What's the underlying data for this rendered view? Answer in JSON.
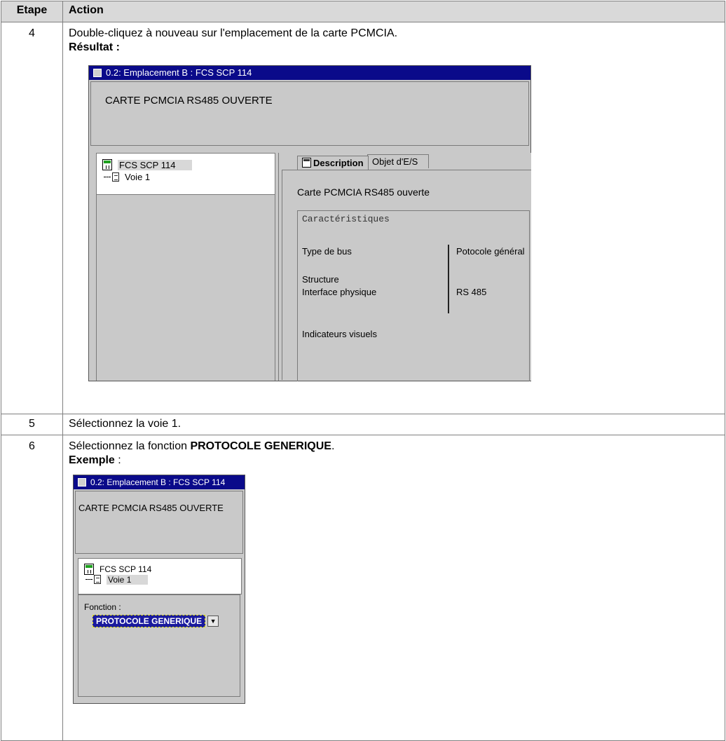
{
  "table": {
    "headers": [
      "Etape",
      "Action"
    ]
  },
  "rows": {
    "r4": {
      "step": "4",
      "instruction": "Double-cliquez à nouveau sur l'emplacement de la carte PCMCIA.",
      "result_label": "Résultat :",
      "window": {
        "title": "0.2: Emplacement B : FCS SCP 114",
        "banner": "CARTE PCMCIA RS485 OUVERTE",
        "tree_module": "FCS SCP 114",
        "tree_channel": "Voie 1",
        "tab_description": "Description",
        "tab_io": "Objet d'E/S",
        "card_title": "Carte PCMCIA RS485 ouverte",
        "group_title": "Caractéristiques",
        "bus_label": "Type de bus",
        "bus_value": "Potocole général",
        "structure_label": "Structure",
        "interface_label": "Interface physique",
        "interface_value": "RS 485",
        "indicators_label": "Indicateurs visuels"
      }
    },
    "r5": {
      "step": "5",
      "instruction": "Sélectionnez la voie 1."
    },
    "r6": {
      "step": "6",
      "instruction_prefix": "Sélectionnez la fonction ",
      "instruction_bold": "PROTOCOLE GENERIQUE",
      "instruction_suffix": ".",
      "example_label": "Exemple",
      "example_suffix": " :",
      "window": {
        "title": "0.2: Emplacement B : FCS SCP 114",
        "banner": "CARTE PCMCIA RS485 OUVERTE",
        "tree_module": "FCS SCP 114",
        "tree_channel": "Voie 1",
        "function_label": "Fonction :",
        "function_value": "PROTOCOLE GENERIQUE",
        "dropdown_glyph": "▼"
      }
    }
  },
  "colors": {
    "title_bar": "#0a0a8a",
    "header_bg": "#d9d9d9",
    "window_bg": "#c9c9c9"
  }
}
